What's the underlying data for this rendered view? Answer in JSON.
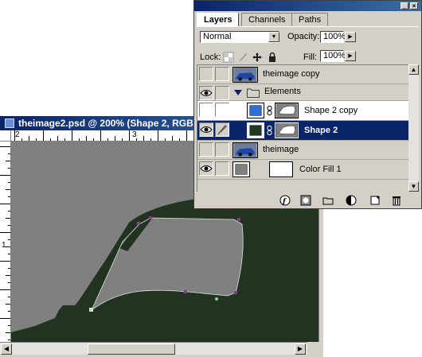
{
  "document": {
    "title": "theimage2.psd @ 200% (Shape 2, RGB)",
    "ruler_top_numbers": [
      "2",
      "3"
    ],
    "ruler_left_numbers": [
      "1"
    ],
    "canvas_colors": {
      "background": "#808080",
      "shape": "#223322",
      "path_points": "#8a3a8a"
    }
  },
  "layers_panel": {
    "tabs": [
      {
        "label": "Layers",
        "active": true
      },
      {
        "label": "Channels",
        "active": false
      },
      {
        "label": "Paths",
        "active": false
      }
    ],
    "blend_mode": "Normal",
    "opacity_label": "Opacity:",
    "opacity_value": "100%",
    "lock_label": "Lock:",
    "fill_label": "Fill:",
    "fill_value": "100%",
    "layers": [
      {
        "name": "theimage copy",
        "visible": false,
        "type": "image"
      },
      {
        "name": "Elements",
        "visible": true,
        "type": "group",
        "expanded": true
      },
      {
        "name": "Shape 2 copy",
        "visible": false,
        "type": "shape",
        "fill_color": "#2f6fd8"
      },
      {
        "name": "Shape 2",
        "visible": true,
        "type": "shape",
        "selected": true,
        "fill_color": "#1f3b1f"
      },
      {
        "name": "theimage",
        "visible": false,
        "type": "image"
      },
      {
        "name": "Color Fill 1",
        "visible": true,
        "type": "fill",
        "fill_color": "#808080"
      }
    ],
    "bottom_icons": [
      "layer-style-icon",
      "mask-icon",
      "new-set-icon",
      "adjustment-layer-icon",
      "new-layer-icon",
      "trash-icon"
    ]
  }
}
